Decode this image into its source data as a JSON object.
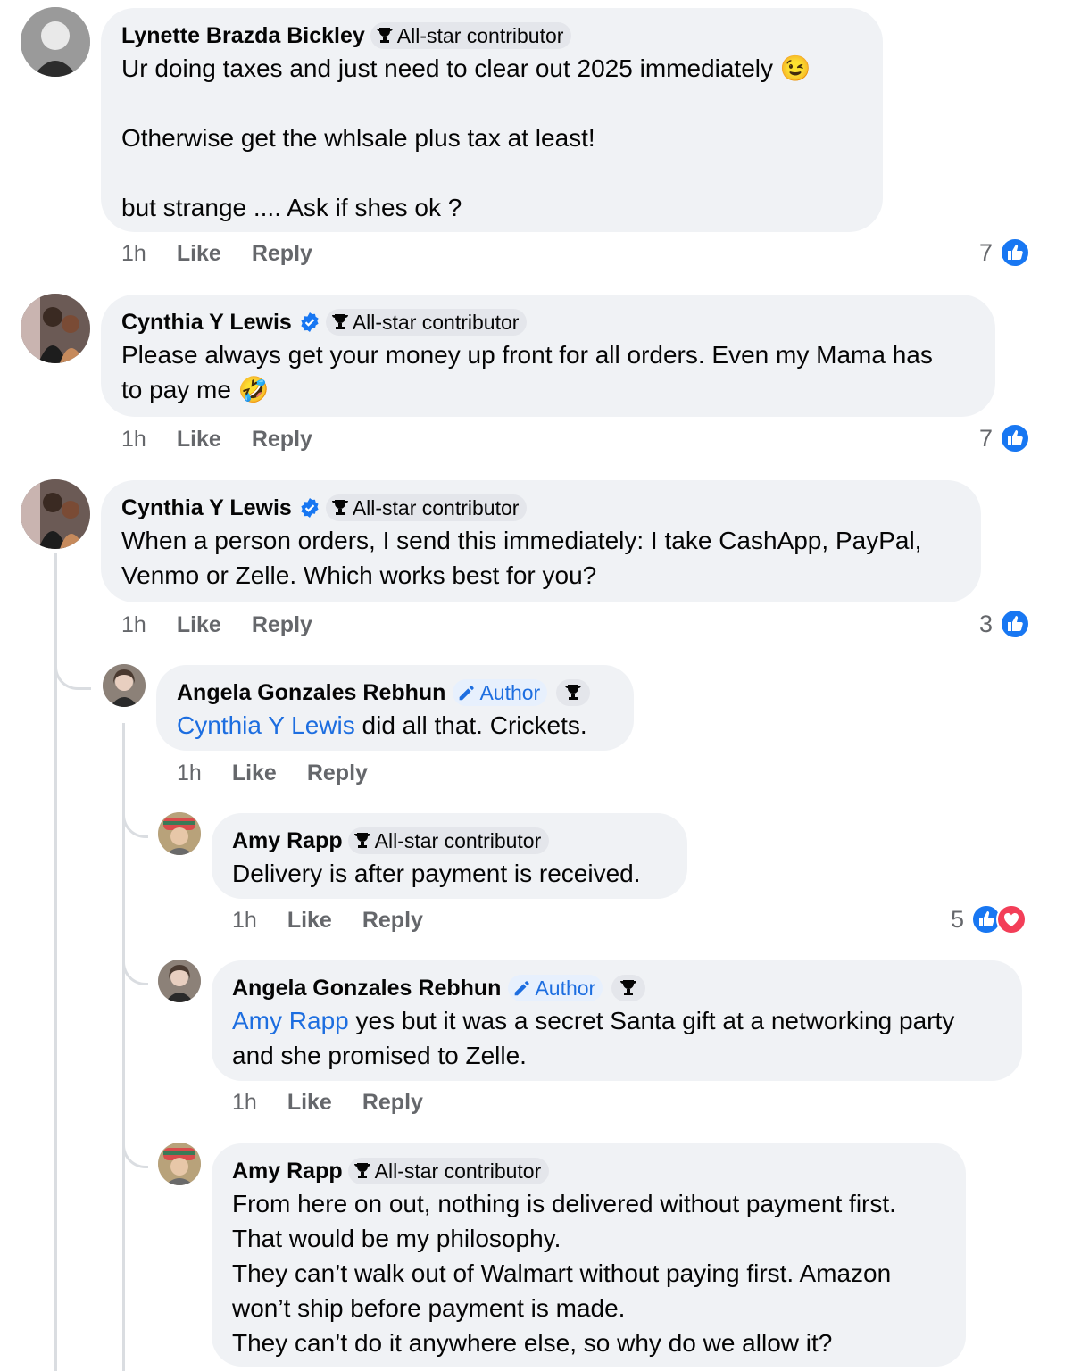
{
  "comments": [
    {
      "name": "Lynette Brazda Bickley",
      "badge": "All-star contributor",
      "text": "Ur doing taxes and just need to clear out 2025 immediately 😉\n\nOtherwise get the whlsale plus tax at least!\n\nbut strange .... Ask if shes ok ?",
      "time": "1h",
      "like": "Like",
      "reply": "Reply",
      "reaction_count": "7",
      "reactions": [
        "like-icon"
      ]
    },
    {
      "name": "Cynthia Y Lewis",
      "verified": true,
      "badge": "All-star contributor",
      "text": "Please always get your money up front for all orders. Even my Mama has\nto pay me 🤣",
      "time": "1h",
      "like": "Like",
      "reply": "Reply",
      "reaction_count": "7",
      "reactions": [
        "like-icon"
      ]
    },
    {
      "name": "Cynthia Y Lewis",
      "verified": true,
      "badge": "All-star contributor",
      "text": "When a person orders, I send this immediately: I take CashApp, PayPal,\nVenmo or Zelle. Which works best for you?",
      "time": "1h",
      "like": "Like",
      "reply": "Reply",
      "reaction_count": "3",
      "reactions": [
        "like-icon"
      ],
      "replies": [
        {
          "name": "Angela Gonzales Rebhun",
          "author_label": "Author",
          "mention": "Cynthia Y Lewis",
          "text": " did all that. Crickets.",
          "time": "1h",
          "like": "Like",
          "reply": "Reply"
        },
        {
          "name": "Amy Rapp",
          "badge": "All-star contributor",
          "text": "Delivery is after payment is received.",
          "time": "1h",
          "like": "Like",
          "reply": "Reply",
          "reaction_count": "5",
          "reactions": [
            "like-icon",
            "love-icon"
          ]
        },
        {
          "name": "Angela Gonzales Rebhun",
          "author_label": "Author",
          "mention": "Amy Rapp",
          "text": " yes but it was a secret Santa gift at a networking party\nand she promised to Zelle.",
          "time": "1h",
          "like": "Like",
          "reply": "Reply"
        },
        {
          "name": "Amy Rapp",
          "badge": "All-star contributor",
          "text": "From here on out, nothing is delivered without payment first.\nThat would be my philosophy.\nThey can’t walk out of Walmart without paying first. Amazon\nwon’t ship before payment is made.\nThey can’t do it anywhere else, so why do we allow it?"
        }
      ]
    }
  ],
  "colors": {
    "bubble": "#f0f2f5",
    "link": "#1d6ee0",
    "meta": "#65676b",
    "like_blue": "#1877f2",
    "love_red": "#f33e58"
  }
}
